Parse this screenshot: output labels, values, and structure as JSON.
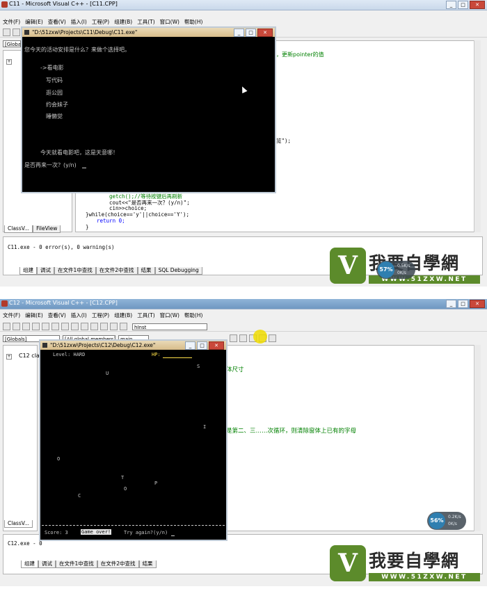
{
  "top": {
    "window_title": "C11 - Microsoft Visual C++ - [C11.CPP]",
    "menu": [
      "文件(F)",
      "编辑(E)",
      "查看(V)",
      "插入(I)",
      "工程(P)",
      "组建(B)",
      "工具(T)",
      "窗口(W)",
      "帮助(H)"
    ],
    "globals_combo": "[Globals]",
    "editor_comment_fragment": "，更新pointer的值",
    "editor_fragment_2": "览\");",
    "code_lines": [
      "getch();//等待按键后再刷新",
      "cout<<\"是否再来一次？(y/n)\";",
      "cin>>choice;",
      "}while(choice=='y'||choice=='Y');",
      "return 0;",
      "}"
    ],
    "workspace_tabs": [
      "ClassV...",
      "FileView"
    ],
    "output_line": "C11.exe - 0 error(s), 0 warning(s)",
    "output_tabs": [
      "组建",
      "调试",
      "在文件1中查找",
      "在文件2中查找",
      "结果",
      "SQL Debugging"
    ],
    "console": {
      "title": "\"D:\\51zxw\\Projects\\C11\\Debug\\C11.exe\"",
      "prompt": "您今天的活动安排是什么？来做个选择吧。",
      "options": [
        "->看电影",
        "写代码",
        "逛公园",
        "约会妹子",
        "睡懒觉"
      ],
      "result": "今天就看电影吧，这是天意哪！",
      "again": "是否再来一次？(y/n)"
    },
    "gauge": {
      "percent": "57%",
      "up": "0.5K/s",
      "down": "0K/s"
    }
  },
  "bottom": {
    "window_title": "C12 - Microsoft Visual C++ - [C12.CPP]",
    "menu": [
      "文件(F)",
      "编辑(E)",
      "查看(V)",
      "插入(I)",
      "工程(P)",
      "组建(B)",
      "工具(T)",
      "窗口(W)",
      "帮助(H)"
    ],
    "find_combo": "hInst",
    "globals_combo": "[Globals]",
    "members_combo": "[All global members]",
    "main_combo": "main",
    "workspace_root": "C12 cla",
    "editor_comment_1": "体尺寸",
    "editor_comment_2": "是第二、三……次循环，则清除窗体上已有的字母",
    "workspace_tabs": [
      "ClassV..."
    ],
    "output_line": "C12.exe - 0",
    "output_tabs": [
      "组建",
      "调试",
      "在文件1中查找",
      "在文件2中查找",
      "结果"
    ],
    "console": {
      "title": "\"D:\\51zxw\\Projects\\C12\\Debug\\C12.exe\"",
      "level": "Level: HARD",
      "hp_label": "HP:",
      "letters": [
        "S",
        "U",
        "I",
        "O",
        "T",
        "P",
        "O",
        "C"
      ],
      "score": "Score: 3",
      "game_over": "Game over!",
      "try_again": "Try again?(y/n)"
    },
    "gauge": {
      "percent": "56%",
      "up": "0.2K/s",
      "down": "0K/s"
    }
  },
  "watermark": {
    "chinese": "我要自學網",
    "url": "WWW.51ZXW.NET",
    "v_letter": "V"
  }
}
